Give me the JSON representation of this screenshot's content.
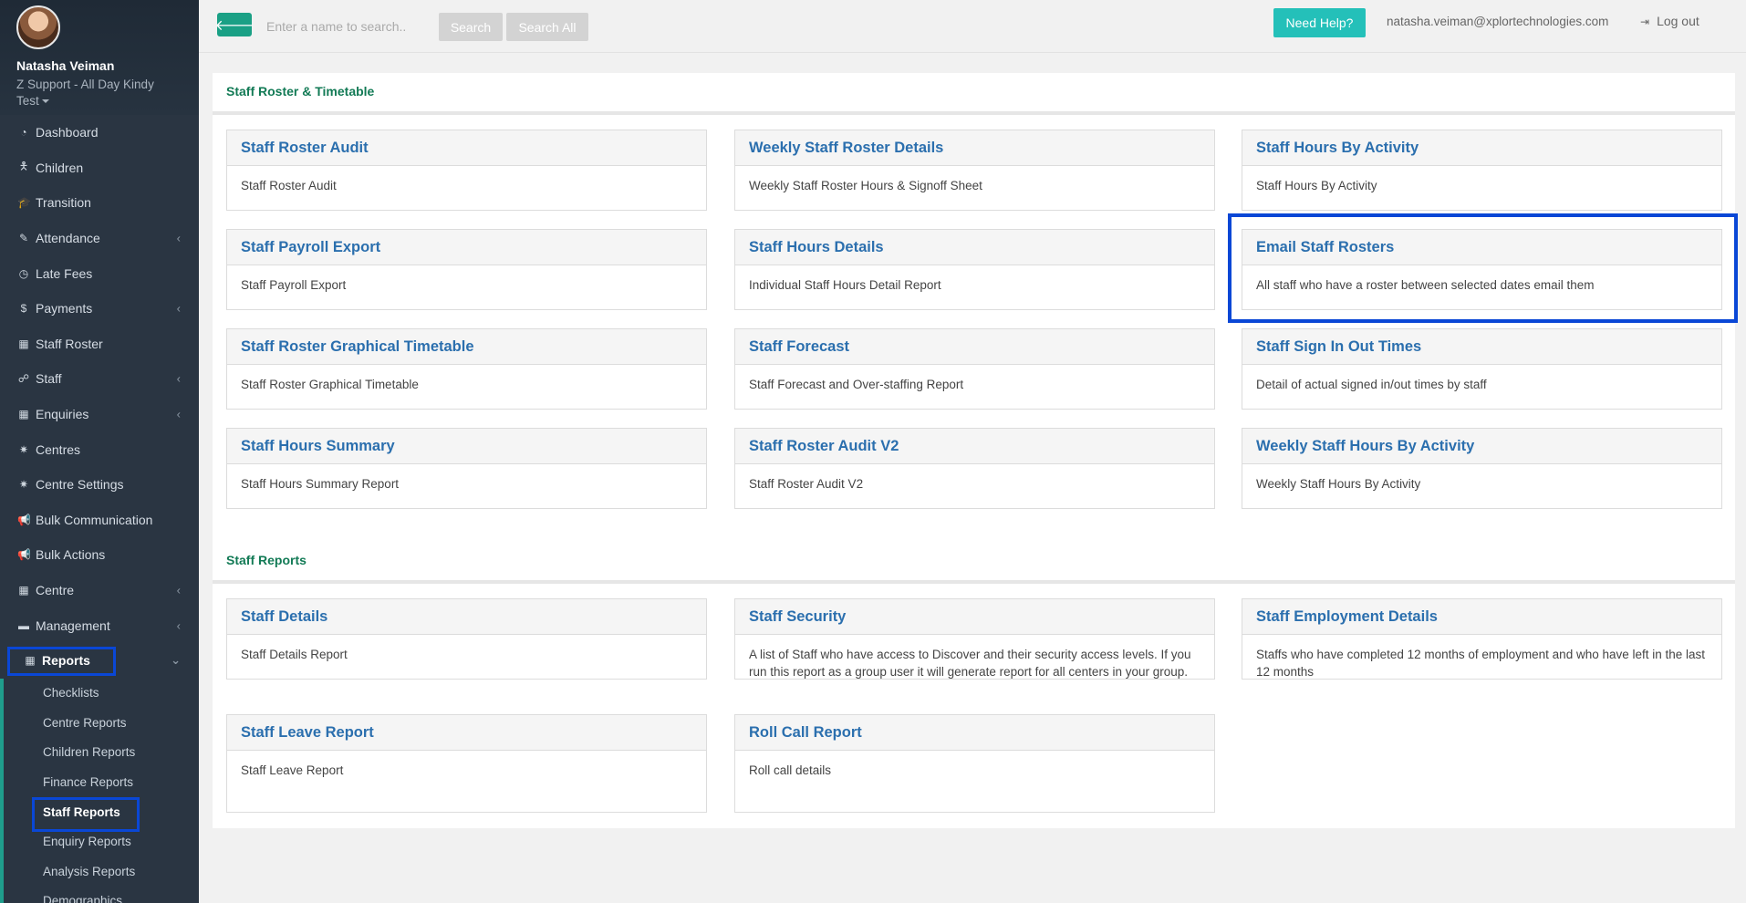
{
  "profile": {
    "name": "Natasha Veiman",
    "org_line1": "Z Support - All Day Kindy",
    "org_line2": "Test"
  },
  "nav": [
    {
      "label": "Dashboard",
      "icon": "dashboard-icon",
      "glyph": "◔",
      "chevron": false
    },
    {
      "label": "Children",
      "icon": "child-icon",
      "glyph": "🯅",
      "chevron": false
    },
    {
      "label": "Transition",
      "icon": "graduation-cap-icon",
      "glyph": "🎓",
      "chevron": false
    },
    {
      "label": "Attendance",
      "icon": "edit-icon",
      "glyph": "✎",
      "chevron": true
    },
    {
      "label": "Late Fees",
      "icon": "clock-icon",
      "glyph": "◷",
      "chevron": false
    },
    {
      "label": "Payments",
      "icon": "dollar-icon",
      "glyph": "$",
      "chevron": true
    },
    {
      "label": "Staff Roster",
      "icon": "calendar-icon",
      "glyph": "▦",
      "chevron": false
    },
    {
      "label": "Staff",
      "icon": "sitemap-icon",
      "glyph": "☍",
      "chevron": true
    },
    {
      "label": "Enquiries",
      "icon": "grid-icon",
      "glyph": "▦",
      "chevron": true
    },
    {
      "label": "Centres",
      "icon": "cog-icon",
      "glyph": "✷",
      "chevron": false
    },
    {
      "label": "Centre Settings",
      "icon": "cog-icon",
      "glyph": "✷",
      "chevron": false
    },
    {
      "label": "Bulk Communication",
      "icon": "bullhorn-icon",
      "glyph": "📢",
      "chevron": false
    },
    {
      "label": "Bulk Actions",
      "icon": "bullhorn-icon",
      "glyph": "📢",
      "chevron": false
    },
    {
      "label": "Centre",
      "icon": "grid-icon",
      "glyph": "▦",
      "chevron": true
    },
    {
      "label": "Management",
      "icon": "folder-icon",
      "glyph": "▬",
      "chevron": true
    }
  ],
  "reports_nav": {
    "label": "Reports",
    "icon": "grid-icon"
  },
  "subnav": [
    {
      "label": "Checklists",
      "current": false
    },
    {
      "label": "Centre Reports",
      "current": false
    },
    {
      "label": "Children Reports",
      "current": false
    },
    {
      "label": "Finance Reports",
      "current": false
    },
    {
      "label": "Staff Reports",
      "current": true
    },
    {
      "label": "Enquiry Reports",
      "current": false
    },
    {
      "label": "Analysis Reports",
      "current": false
    },
    {
      "label": "Demographics",
      "current": false
    }
  ],
  "topbar": {
    "search_placeholder": "Enter a name to search..",
    "search_label": "Search",
    "search_all_label": "Search All",
    "help_label": "Need Help?",
    "email": "natasha.veiman@xplortechnologies.com",
    "logout_label": "Log out"
  },
  "sections": {
    "roster": {
      "title": "Staff Roster & Timetable",
      "cards": [
        {
          "title": "Staff Roster Audit",
          "desc": "Staff Roster Audit"
        },
        {
          "title": "Weekly Staff Roster Details",
          "desc": "Weekly Staff Roster Hours & Signoff Sheet"
        },
        {
          "title": "Staff Hours By Activity",
          "desc": "Staff Hours By Activity"
        },
        {
          "title": "Staff Payroll Export",
          "desc": "Staff Payroll Export"
        },
        {
          "title": "Staff Hours Details",
          "desc": "Individual Staff Hours Detail Report"
        },
        {
          "title": "Email Staff Rosters",
          "desc": "All staff who have a roster between selected dates email them"
        },
        {
          "title": "Staff Roster Graphical Timetable",
          "desc": "Staff Roster Graphical Timetable"
        },
        {
          "title": "Staff Forecast",
          "desc": "Staff Forecast and Over-staffing Report"
        },
        {
          "title": "Staff Sign In Out Times",
          "desc": "Detail of actual signed in/out times by staff"
        },
        {
          "title": "Staff Hours Summary",
          "desc": "Staff Hours Summary Report"
        },
        {
          "title": "Staff Roster Audit V2",
          "desc": "Staff Roster Audit V2"
        },
        {
          "title": "Weekly Staff Hours By Activity",
          "desc": "Weekly Staff Hours By Activity"
        }
      ]
    },
    "staff": {
      "title": "Staff Reports",
      "cards": [
        {
          "title": "Staff Details",
          "desc": "Staff Details Report"
        },
        {
          "title": "Staff Security",
          "desc": "A list of Staff who have access to Discover and their security access levels. If you run this report as a group user it will generate report for all centers in your group."
        },
        {
          "title": "Staff Employment Details",
          "desc": "Staffs who have completed 12 months of employment and who have left in the last 12 months"
        },
        {
          "title": "Staff Leave Report",
          "desc": "Staff Leave Report"
        },
        {
          "title": "Roll Call Report",
          "desc": "Roll call details"
        }
      ]
    }
  }
}
